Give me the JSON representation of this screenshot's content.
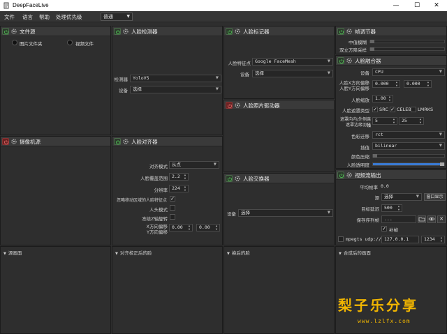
{
  "window": {
    "title": "DeepFaceLive",
    "minimize": "—",
    "maximize": "☐",
    "close": "✕"
  },
  "menu": {
    "file": "文件",
    "language": "语言",
    "help": "帮助",
    "priority_label": "处理优先级",
    "priority_value": "普通"
  },
  "panels": {
    "file_source": {
      "title": "文件源",
      "radio_folder": "图片文件夹",
      "radio_video": "视频文件"
    },
    "camera_source": {
      "title": "摄像机源"
    },
    "face_detector": {
      "title": "人脸检测器",
      "detector_label": "检测器",
      "detector_value": "YoloV5",
      "device_label": "设备",
      "device_value": "选择"
    },
    "face_aligner": {
      "title": "人脸对齐器",
      "align_mode_label": "对齐模式",
      "align_mode_value": "从点",
      "coverage_label": "人脸覆盖范围",
      "coverage_value": "2.2",
      "resolution_label": "分辨率",
      "resolution_value": "224",
      "exclude_moving_label": "忽略移动区域的人脸特征点",
      "head_mode_label": "人头模式",
      "freeze_z_label": "冻结Z轴旋转",
      "x_offset_label": "X方向偏移",
      "y_offset_label": "Y方向偏移",
      "x_offset_value": "0.00",
      "y_offset_value": "0.00"
    },
    "face_marker": {
      "title": "人脸标记器",
      "marker_label": "人脸特征点",
      "marker_value": "Google FaceMesh",
      "device_label": "设备",
      "device_value": "选择"
    },
    "face_animator": {
      "title": "人脸照片驱动器"
    },
    "face_swapper": {
      "title": "人脸交换器",
      "device_label": "设备",
      "device_value": "选择"
    },
    "frame_adjuster": {
      "title": "帧调节器",
      "median_blur_label": "中值模糊",
      "degrade_label": "双立方降采样"
    },
    "face_merger": {
      "title": "人脸融合器",
      "device_label": "设备",
      "device_value": "CPU",
      "x_offset_label": "人脸X方向偏移",
      "y_offset_label": "人脸Y方向偏移",
      "x_offset_value": "0.000",
      "y_offset_value": "0.000",
      "scale_label": "人脸缩放",
      "scale_value": "1.00",
      "mask_type_label": "人脸遮罩类型",
      "mask_src": "SRC",
      "mask_celeb": "CELEB",
      "mask_lmrks": "LMRKS",
      "erode_label": "遮罩向内/外侧腐蚀",
      "blur_label": "遮罩边缘羽化",
      "erode_value": "5",
      "blur_value": "25",
      "color_transfer_label": "色彩迁移",
      "color_transfer_value": "rct",
      "interpolation_label": "插值",
      "interpolation_value": "bilinear",
      "color_compression_label": "颜色压缩",
      "opacity_label": "人脸透明度"
    },
    "stream_output": {
      "title": "视频流输出",
      "avg_fps_label": "平均帧率",
      "avg_fps_value": "0.0",
      "source_label": "源",
      "source_value": "选择",
      "window_button": "窗口显示",
      "target_delay_label": "目标延迟",
      "target_delay_value": "500",
      "save_path_label": "保存序列帧",
      "save_path_value": "...",
      "fill_frame_label": "补帧",
      "mpegts_label": "mpegts udp://",
      "mpegts_ip": "127.0.0.1",
      "mpegts_port": "1234"
    }
  },
  "viewers": {
    "source_frame": "源画面",
    "aligned_face": "对齐校正后的脸",
    "swapped_face": "换后的脸",
    "merged_frame": "合成后的画面"
  },
  "watermark": {
    "text": "梨子乐分享",
    "url": "www.lzlfx.com"
  },
  "colors": {
    "accent": "#3a7bd5",
    "power_on": "#4caf50",
    "power_off": "#a03030",
    "watermark": "#f2b600"
  },
  "slider_values": {
    "median_blur": 0.0,
    "degrade": 0.0,
    "color_compression": 0.0,
    "opacity": 1.0
  }
}
